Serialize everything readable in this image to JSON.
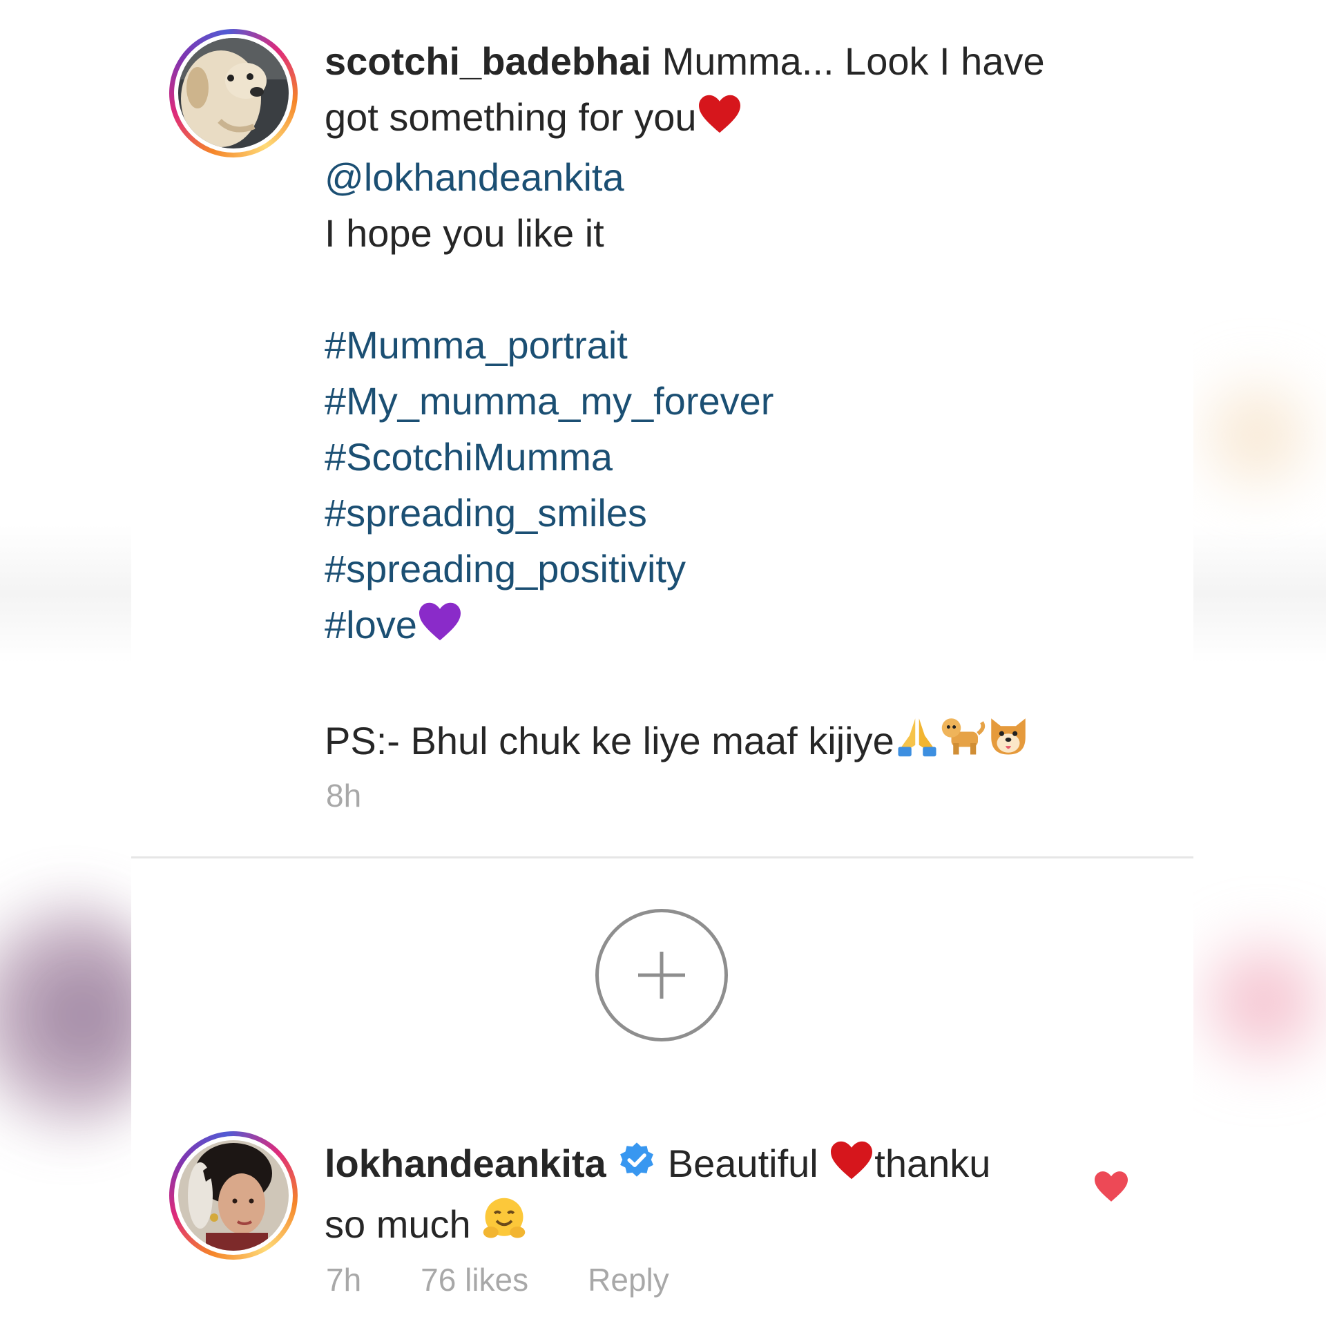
{
  "post": {
    "username": "scotchi_badebhai",
    "caption_line1": " Mumma... Look I have",
    "caption_line2": "got something for you",
    "mention": "@lokhandeankita",
    "caption_line4": "I hope you like it",
    "hashtags": [
      "#Mumma_portrait",
      "#My_mumma_my_forever",
      "#ScotchiMumma",
      "#spreading_smiles",
      "#spreading_positivity",
      "#love"
    ],
    "ps_text": "PS:- Bhul chuk ke liye maaf kijiye",
    "time": "8h"
  },
  "comment": {
    "username": "lokhandeankita",
    "text_part1": " Beautiful ",
    "text_part2": "thanku",
    "text_line2": "so much ",
    "time": "7h",
    "likes": "76 likes",
    "reply_label": "Reply"
  },
  "icons": {
    "avatar_post": "dog-avatar-icon",
    "avatar_comment": "woman-avatar-icon",
    "verified": "verified-badge-icon",
    "add": "plus-icon",
    "like": "heart-icon"
  },
  "colors": {
    "text": "#262626",
    "link": "#1b4f73",
    "muted": "#a8a8a8",
    "verified": "#3897f0",
    "like_red": "#ed4956"
  }
}
